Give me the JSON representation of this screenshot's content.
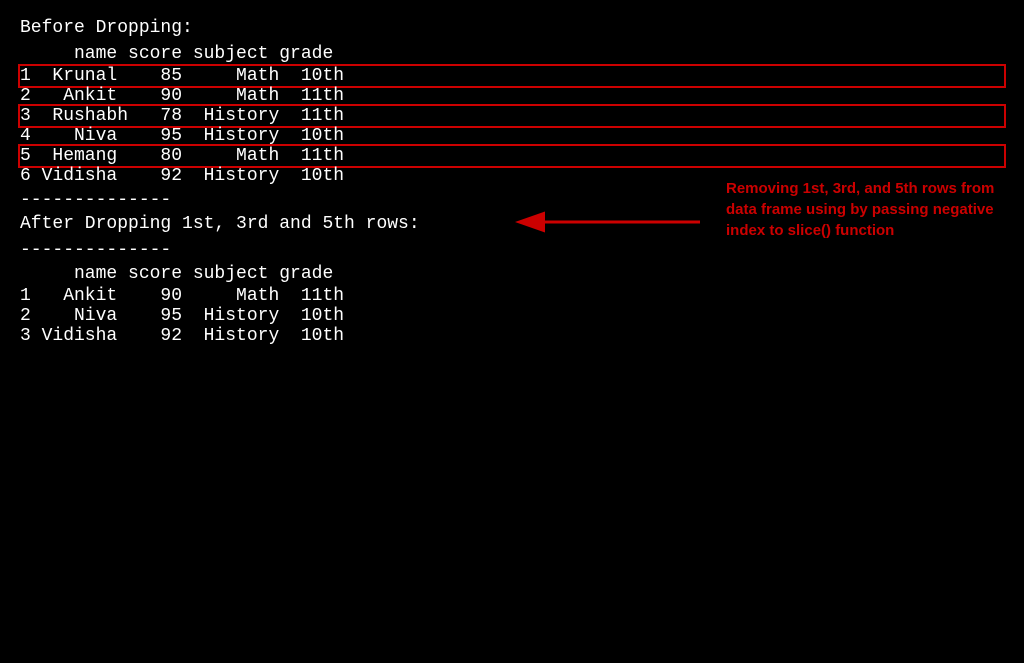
{
  "before": {
    "title": "Before Dropping:",
    "header": "     name score subject grade",
    "rows": [
      {
        "id": "1",
        "text": "1  Krunal    85     Math  10th",
        "highlighted": true
      },
      {
        "id": "2",
        "text": "2   Ankit    90     Math  11th",
        "highlighted": false
      },
      {
        "id": "3",
        "text": "3  Rushabh   78  History  11th",
        "highlighted": true
      },
      {
        "id": "4",
        "text": "4    Niva    95  History  10th",
        "highlighted": false
      },
      {
        "id": "5",
        "text": "5  Hemang    80     Math  11th",
        "highlighted": true
      },
      {
        "id": "6",
        "text": "6 Vidisha    92  History  10th",
        "highlighted": false
      }
    ],
    "separator": "--------------"
  },
  "after": {
    "title": "After Dropping 1st, 3rd and 5th rows:",
    "separator": "--------------",
    "header": "     name score subject grade",
    "rows": [
      {
        "id": "1",
        "text": "1   Ankit    90     Math  11th"
      },
      {
        "id": "2",
        "text": "2    Niva    95  History  10th"
      },
      {
        "id": "3",
        "text": "3 Vidisha    92  History  10th"
      }
    ]
  },
  "annotation": {
    "text": "Removing 1st, 3rd, and 5th rows from data frame using by passing negative index to slice() function"
  }
}
